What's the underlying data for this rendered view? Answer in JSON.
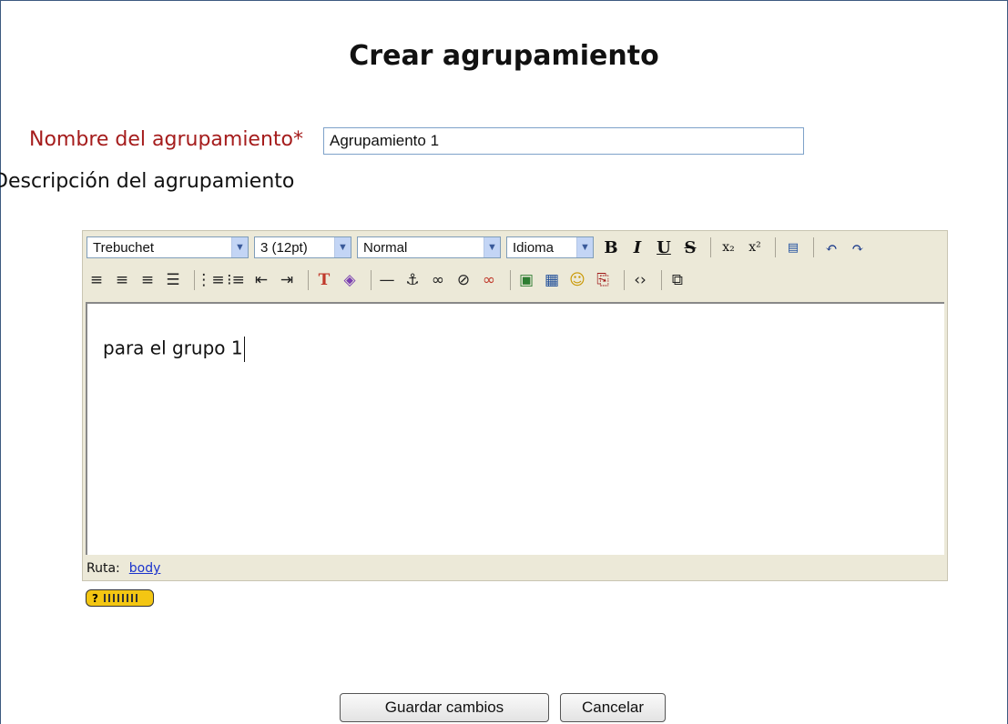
{
  "page": {
    "title": "Crear agrupamiento"
  },
  "form": {
    "name_label": "Nombre del agrupamiento*",
    "name_value": "Agrupamiento 1",
    "description_label": "Descripción del agrupamiento"
  },
  "toolbar": {
    "font_family": "Trebuchet",
    "font_size": "3 (12pt)",
    "format": "Normal",
    "language": "Idioma",
    "bold": "B",
    "italic": "I",
    "underline": "U",
    "strike": "S",
    "icons_row1": [
      "bold-icon",
      "italic-icon",
      "underline-icon",
      "strikethrough-icon",
      "subscript-icon",
      "superscript-icon",
      "clean-word-icon",
      "undo-icon",
      "redo-icon"
    ],
    "icons_row2": [
      "align-left-icon",
      "align-center-icon",
      "align-right-icon",
      "justify-icon",
      "ordered-list-icon",
      "unordered-list-icon",
      "outdent-icon",
      "indent-icon",
      "text-color-icon",
      "background-color-icon",
      "horizontal-rule-icon",
      "anchor-icon",
      "link-icon",
      "unlink-icon",
      "nolink-icon",
      "insert-image-icon",
      "insert-table-icon",
      "smiley-icon",
      "search-replace-icon",
      "html-source-icon",
      "fullscreen-icon"
    ]
  },
  "editor": {
    "content": "para el grupo 1"
  },
  "path_bar": {
    "label": "Ruta:",
    "path": "body"
  },
  "buttons": {
    "save": "Guardar cambios",
    "cancel": "Cancelar"
  }
}
